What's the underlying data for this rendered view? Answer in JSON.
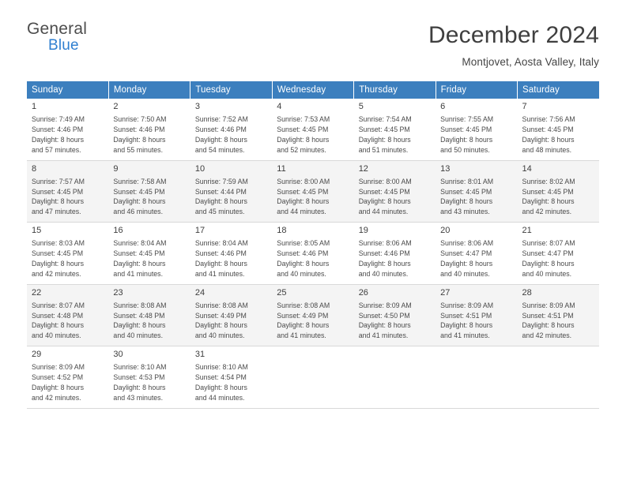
{
  "logo": {
    "line1": "General",
    "line2": "Blue",
    "flag_icon": "blue-flag-icon"
  },
  "header": {
    "title": "December 2024",
    "location": "Montjovet, Aosta Valley, Italy"
  },
  "calendar": {
    "weekday_headers": [
      "Sunday",
      "Monday",
      "Tuesday",
      "Wednesday",
      "Thursday",
      "Friday",
      "Saturday"
    ],
    "accent_color": "#3c7fbe",
    "alt_row_color": "#f4f4f4",
    "weeks": [
      [
        {
          "day": "1",
          "lines": [
            "Sunrise: 7:49 AM",
            "Sunset: 4:46 PM",
            "Daylight: 8 hours",
            "and 57 minutes."
          ]
        },
        {
          "day": "2",
          "lines": [
            "Sunrise: 7:50 AM",
            "Sunset: 4:46 PM",
            "Daylight: 8 hours",
            "and 55 minutes."
          ]
        },
        {
          "day": "3",
          "lines": [
            "Sunrise: 7:52 AM",
            "Sunset: 4:46 PM",
            "Daylight: 8 hours",
            "and 54 minutes."
          ]
        },
        {
          "day": "4",
          "lines": [
            "Sunrise: 7:53 AM",
            "Sunset: 4:45 PM",
            "Daylight: 8 hours",
            "and 52 minutes."
          ]
        },
        {
          "day": "5",
          "lines": [
            "Sunrise: 7:54 AM",
            "Sunset: 4:45 PM",
            "Daylight: 8 hours",
            "and 51 minutes."
          ]
        },
        {
          "day": "6",
          "lines": [
            "Sunrise: 7:55 AM",
            "Sunset: 4:45 PM",
            "Daylight: 8 hours",
            "and 50 minutes."
          ]
        },
        {
          "day": "7",
          "lines": [
            "Sunrise: 7:56 AM",
            "Sunset: 4:45 PM",
            "Daylight: 8 hours",
            "and 48 minutes."
          ]
        }
      ],
      [
        {
          "day": "8",
          "lines": [
            "Sunrise: 7:57 AM",
            "Sunset: 4:45 PM",
            "Daylight: 8 hours",
            "and 47 minutes."
          ]
        },
        {
          "day": "9",
          "lines": [
            "Sunrise: 7:58 AM",
            "Sunset: 4:45 PM",
            "Daylight: 8 hours",
            "and 46 minutes."
          ]
        },
        {
          "day": "10",
          "lines": [
            "Sunrise: 7:59 AM",
            "Sunset: 4:44 PM",
            "Daylight: 8 hours",
            "and 45 minutes."
          ]
        },
        {
          "day": "11",
          "lines": [
            "Sunrise: 8:00 AM",
            "Sunset: 4:45 PM",
            "Daylight: 8 hours",
            "and 44 minutes."
          ]
        },
        {
          "day": "12",
          "lines": [
            "Sunrise: 8:00 AM",
            "Sunset: 4:45 PM",
            "Daylight: 8 hours",
            "and 44 minutes."
          ]
        },
        {
          "day": "13",
          "lines": [
            "Sunrise: 8:01 AM",
            "Sunset: 4:45 PM",
            "Daylight: 8 hours",
            "and 43 minutes."
          ]
        },
        {
          "day": "14",
          "lines": [
            "Sunrise: 8:02 AM",
            "Sunset: 4:45 PM",
            "Daylight: 8 hours",
            "and 42 minutes."
          ]
        }
      ],
      [
        {
          "day": "15",
          "lines": [
            "Sunrise: 8:03 AM",
            "Sunset: 4:45 PM",
            "Daylight: 8 hours",
            "and 42 minutes."
          ]
        },
        {
          "day": "16",
          "lines": [
            "Sunrise: 8:04 AM",
            "Sunset: 4:45 PM",
            "Daylight: 8 hours",
            "and 41 minutes."
          ]
        },
        {
          "day": "17",
          "lines": [
            "Sunrise: 8:04 AM",
            "Sunset: 4:46 PM",
            "Daylight: 8 hours",
            "and 41 minutes."
          ]
        },
        {
          "day": "18",
          "lines": [
            "Sunrise: 8:05 AM",
            "Sunset: 4:46 PM",
            "Daylight: 8 hours",
            "and 40 minutes."
          ]
        },
        {
          "day": "19",
          "lines": [
            "Sunrise: 8:06 AM",
            "Sunset: 4:46 PM",
            "Daylight: 8 hours",
            "and 40 minutes."
          ]
        },
        {
          "day": "20",
          "lines": [
            "Sunrise: 8:06 AM",
            "Sunset: 4:47 PM",
            "Daylight: 8 hours",
            "and 40 minutes."
          ]
        },
        {
          "day": "21",
          "lines": [
            "Sunrise: 8:07 AM",
            "Sunset: 4:47 PM",
            "Daylight: 8 hours",
            "and 40 minutes."
          ]
        }
      ],
      [
        {
          "day": "22",
          "lines": [
            "Sunrise: 8:07 AM",
            "Sunset: 4:48 PM",
            "Daylight: 8 hours",
            "and 40 minutes."
          ]
        },
        {
          "day": "23",
          "lines": [
            "Sunrise: 8:08 AM",
            "Sunset: 4:48 PM",
            "Daylight: 8 hours",
            "and 40 minutes."
          ]
        },
        {
          "day": "24",
          "lines": [
            "Sunrise: 8:08 AM",
            "Sunset: 4:49 PM",
            "Daylight: 8 hours",
            "and 40 minutes."
          ]
        },
        {
          "day": "25",
          "lines": [
            "Sunrise: 8:08 AM",
            "Sunset: 4:49 PM",
            "Daylight: 8 hours",
            "and 41 minutes."
          ]
        },
        {
          "day": "26",
          "lines": [
            "Sunrise: 8:09 AM",
            "Sunset: 4:50 PM",
            "Daylight: 8 hours",
            "and 41 minutes."
          ]
        },
        {
          "day": "27",
          "lines": [
            "Sunrise: 8:09 AM",
            "Sunset: 4:51 PM",
            "Daylight: 8 hours",
            "and 41 minutes."
          ]
        },
        {
          "day": "28",
          "lines": [
            "Sunrise: 8:09 AM",
            "Sunset: 4:51 PM",
            "Daylight: 8 hours",
            "and 42 minutes."
          ]
        }
      ],
      [
        {
          "day": "29",
          "lines": [
            "Sunrise: 8:09 AM",
            "Sunset: 4:52 PM",
            "Daylight: 8 hours",
            "and 42 minutes."
          ]
        },
        {
          "day": "30",
          "lines": [
            "Sunrise: 8:10 AM",
            "Sunset: 4:53 PM",
            "Daylight: 8 hours",
            "and 43 minutes."
          ]
        },
        {
          "day": "31",
          "lines": [
            "Sunrise: 8:10 AM",
            "Sunset: 4:54 PM",
            "Daylight: 8 hours",
            "and 44 minutes."
          ]
        },
        {
          "day": "",
          "lines": []
        },
        {
          "day": "",
          "lines": []
        },
        {
          "day": "",
          "lines": []
        },
        {
          "day": "",
          "lines": []
        }
      ]
    ]
  }
}
